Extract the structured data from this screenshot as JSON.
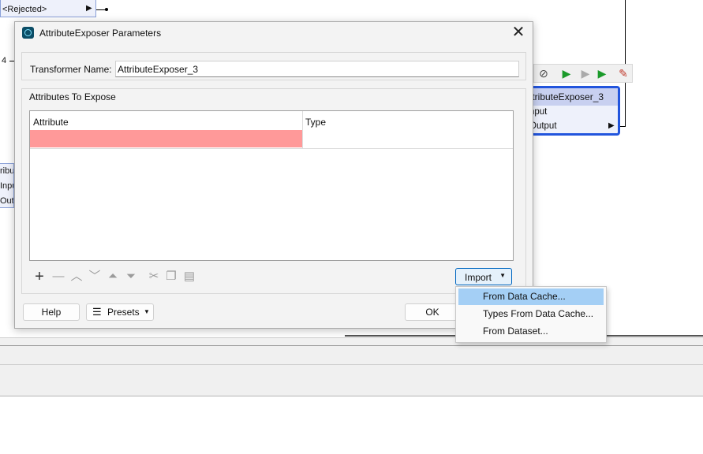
{
  "canvas": {
    "rejected_label": "<Rejected>",
    "row_number": "4",
    "right_node": {
      "title": "ttributeExposer_3",
      "input": "nput",
      "output": "Output"
    },
    "left_node": {
      "title": "ribu",
      "input": "Inpu",
      "output": "Out"
    }
  },
  "dialog": {
    "title": "AttributeExposer Parameters",
    "close_glyph": "✕",
    "transformer_name_label": "Transformer Name:",
    "transformer_name_value": "AttributeExposer_3",
    "attributes_group_label": "Attributes To Expose",
    "table": {
      "columns": [
        "Attribute",
        "Type"
      ],
      "rows": [
        {
          "attribute": "",
          "type": ""
        }
      ]
    },
    "toolbar_icons": [
      "add-icon",
      "remove-icon",
      "move-up-icon",
      "move-down-icon",
      "move-top-icon",
      "move-bottom-icon",
      "cut-icon",
      "copy-icon",
      "paste-icon"
    ],
    "import_label": "Import",
    "help_label": "Help",
    "presets_label": "Presets",
    "ok_label": "OK"
  },
  "import_menu": {
    "items": [
      "From Data Cache...",
      "Types From Data Cache...",
      "From Dataset..."
    ],
    "active_index": 0
  },
  "colors": {
    "invalid_cell": "#ff9999",
    "selection_border": "#2255dd",
    "menu_highlight": "#a4cff5"
  }
}
